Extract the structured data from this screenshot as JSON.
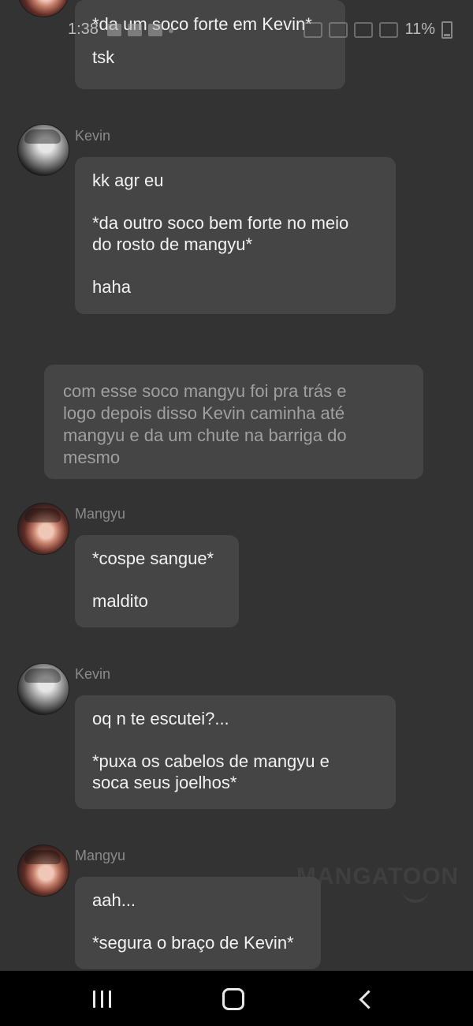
{
  "status_bar": {
    "time": "1:38",
    "battery": "11%"
  },
  "messages": [
    {
      "sender": "",
      "lines": [
        "*da um soco forte em Kevin*",
        "tsk"
      ]
    },
    {
      "sender": "Kevin",
      "lines": [
        "kk agr eu",
        "*da outro soco bem forte no meio\ndo rosto de mangyu*",
        "haha"
      ]
    },
    {
      "narration": "com esse soco mangyu foi pra trás e\nlogo depois disso Kevin caminha até\nmangyu e da um chute na barriga do\nmesmo"
    },
    {
      "sender": "Mangyu",
      "lines": [
        "*cospe sangue*",
        "maldito"
      ]
    },
    {
      "sender": "Kevin",
      "lines": [
        "oq n te escutei?...",
        "*puxa os cabelos de mangyu e\nsoca seus joelhos*"
      ]
    },
    {
      "sender": "Mangyu",
      "lines": [
        "aah...",
        "*segura o braço de Kevin*"
      ]
    }
  ],
  "watermark": "MANGATOON",
  "nav": {
    "recent_icon": "recent-apps-icon",
    "home_icon": "home-icon",
    "back_icon": "back-icon"
  }
}
